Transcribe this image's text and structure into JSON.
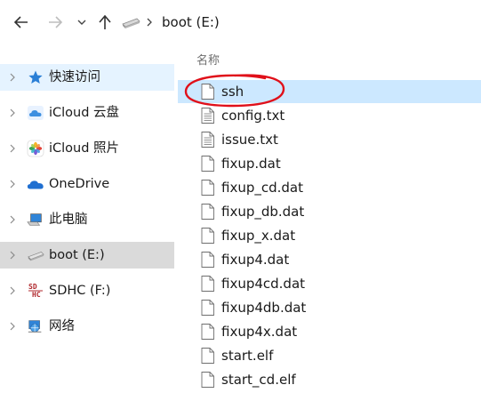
{
  "toolbar": {
    "back_icon": "arrow-left-icon",
    "forward_icon": "arrow-right-icon",
    "recent_icon": "chevron-down-icon",
    "up_icon": "arrow-up-icon"
  },
  "address": {
    "drive_icon": "drive-icon",
    "path": "boot (E:)"
  },
  "sidebar": {
    "items": [
      {
        "label": "快速访问",
        "icon": "star-icon",
        "state": "hover"
      },
      {
        "label": "iCloud 云盘",
        "icon": "icloud-icon",
        "state": ""
      },
      {
        "label": "iCloud 照片",
        "icon": "photos-icon",
        "state": ""
      },
      {
        "label": "OneDrive",
        "icon": "onedrive-icon",
        "state": ""
      },
      {
        "label": "此电脑",
        "icon": "computer-icon",
        "state": ""
      },
      {
        "label": "boot (E:)",
        "icon": "drive-icon",
        "state": "selected"
      },
      {
        "label": "SDHC (F:)",
        "icon": "sdhc-icon",
        "state": ""
      },
      {
        "label": "网络",
        "icon": "network-icon",
        "state": ""
      }
    ]
  },
  "file_list": {
    "column_name": "名称",
    "files": [
      {
        "name": "ssh",
        "type": "blank"
      },
      {
        "name": "config.txt",
        "type": "text"
      },
      {
        "name": "issue.txt",
        "type": "text"
      },
      {
        "name": "fixup.dat",
        "type": "blank"
      },
      {
        "name": "fixup_cd.dat",
        "type": "blank"
      },
      {
        "name": "fixup_db.dat",
        "type": "blank"
      },
      {
        "name": "fixup_x.dat",
        "type": "blank"
      },
      {
        "name": "fixup4.dat",
        "type": "blank"
      },
      {
        "name": "fixup4cd.dat",
        "type": "blank"
      },
      {
        "name": "fixup4db.dat",
        "type": "blank"
      },
      {
        "name": "fixup4x.dat",
        "type": "blank"
      },
      {
        "name": "start.elf",
        "type": "blank"
      },
      {
        "name": "start_cd.elf",
        "type": "blank"
      }
    ],
    "selected_index": 0
  },
  "colors": {
    "selection": "#cce8ff",
    "hover": "#e5f3ff",
    "sidebar_selected": "#dadada",
    "annotation": "#e0101a"
  }
}
